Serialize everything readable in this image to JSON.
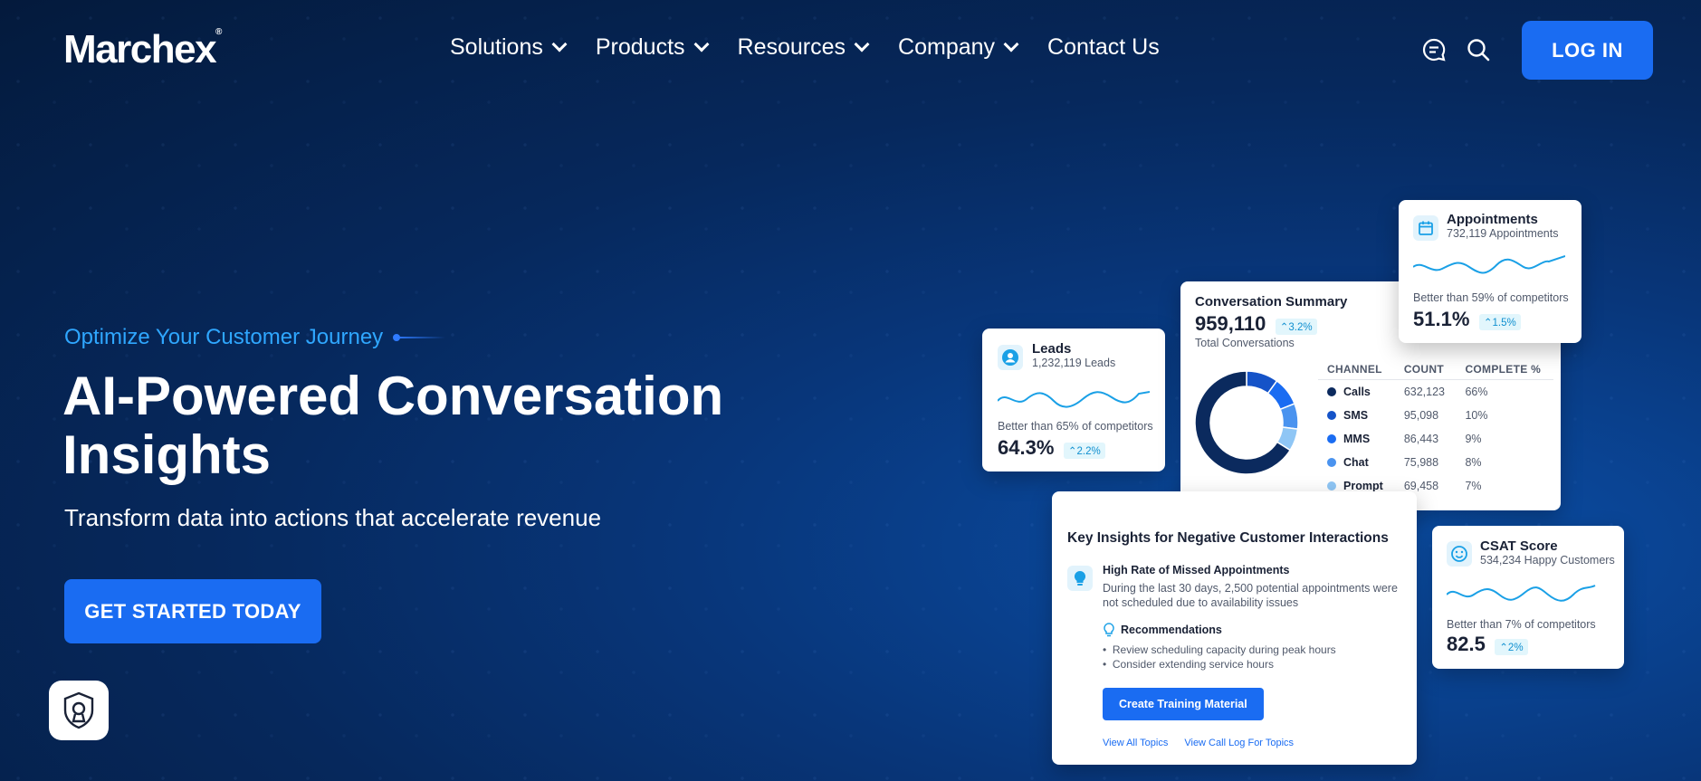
{
  "header": {
    "logo": "Marchex",
    "nav": [
      {
        "label": "Solutions",
        "has_dropdown": true
      },
      {
        "label": "Products",
        "has_dropdown": true
      },
      {
        "label": "Resources",
        "has_dropdown": true
      },
      {
        "label": "Company",
        "has_dropdown": true
      },
      {
        "label": "Contact Us",
        "has_dropdown": false
      }
    ],
    "icons": [
      "chat-icon",
      "search-icon"
    ],
    "login_label": "LOG IN"
  },
  "hero": {
    "eyebrow": "Optimize Your Customer Journey",
    "title": "AI-Powered Conversation Insights",
    "subtitle": "Transform data into actions that accelerate revenue",
    "cta_label": "GET STARTED TODAY"
  },
  "cards": {
    "leads": {
      "title": "Leads",
      "sub": "1,232,119 Leads",
      "comparison": "Better than 65% of competitors",
      "value": "64.3%",
      "delta": "2.2%"
    },
    "appointments": {
      "title": "Appointments",
      "sub": "732,119 Appointments",
      "comparison": "Better than 59% of competitors",
      "value": "51.1%",
      "delta": "1.5%"
    },
    "conversation": {
      "title": "Conversation Summary",
      "value": "959,110",
      "delta": "3.2%",
      "sub": "Total Conversations",
      "columns": [
        "CHANNEL",
        "COUNT",
        "COMPLETE %"
      ],
      "rows": [
        {
          "channel": "Calls",
          "count": "632,123",
          "complete": "66%",
          "color": "#0b2a5e"
        },
        {
          "channel": "SMS",
          "count": "95,098",
          "complete": "10%",
          "color": "#1553c8"
        },
        {
          "channel": "MMS",
          "count": "86,443",
          "complete": "9%",
          "color": "#1a6cf2"
        },
        {
          "channel": "Chat",
          "count": "75,988",
          "complete": "8%",
          "color": "#4a93ef"
        },
        {
          "channel": "Prompt",
          "count": "69,458",
          "complete": "7%",
          "color": "#8fc6f5"
        }
      ]
    },
    "insights": {
      "title": "Key Insights for Negative Customer Interactions",
      "item_title": "High Rate of Missed Appointments",
      "item_body": "During the last 30 days, 2,500 potential appointments were not scheduled due to availability issues",
      "rec_title": "Recommendations",
      "recs": [
        "Review scheduling capacity during peak hours",
        "Consider extending service hours"
      ],
      "button": "Create Training Material",
      "links": [
        "View All Topics",
        "View Call Log For Topics"
      ]
    },
    "csat": {
      "title": "CSAT Score",
      "sub": "534,234 Happy Customers",
      "comparison": "Better than 7% of competitors",
      "value": "82.5",
      "delta": "2%"
    }
  },
  "colors": {
    "accent": "#1a6cf2",
    "eyebrow": "#2fa7ff",
    "sparkline": "#1aa0e6"
  }
}
